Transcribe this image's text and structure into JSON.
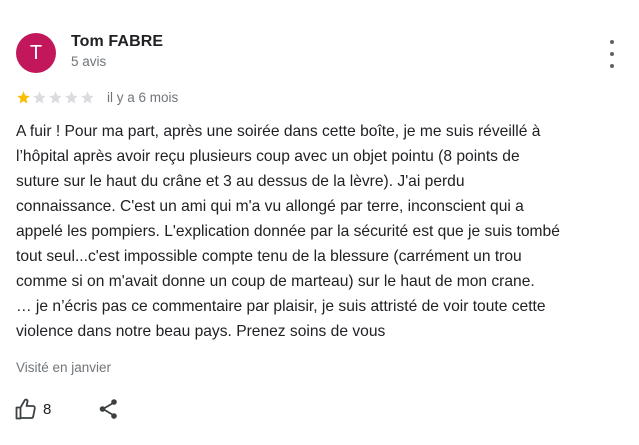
{
  "author": {
    "avatar_letter": "T",
    "avatar_color": "#c2185b",
    "name": "Tom FABRE",
    "review_count": "5 avis"
  },
  "menu": {
    "icon": "more-vert-icon"
  },
  "rating": {
    "stars_filled": 1,
    "stars_total": 5,
    "star_color": "#fbbc04",
    "star_empty_color": "#dadce0",
    "time_ago": "il y a 6 mois"
  },
  "review": {
    "text": "A fuir ! Pour ma part, après une soirée dans cette boîte, je me suis réveillé à\nl’hôpital après avoir reçu plusieurs coup avec un objet pointu (8 points de\nsuture sur le haut du crâne et 3 au dessus de la lèvre). J'ai perdu\nconnaissance. C'est un ami qui m'a vu allongé par terre, inconscient qui a\nappelé les pompiers. L'explication donnée par la sécurité est que je suis tombé\ntout seul...c'est impossible compte tenu de la blessure (carrément un trou\ncomme si on m'avait donne un coup de marteau) sur le haut de mon crane.\n… je n’écris pas ce commentaire par plaisir, je suis attristé de voir toute cette\nviolence dans notre beau pays. Prenez soins de vous"
  },
  "visit": {
    "label": "Visité en janvier"
  },
  "actions": {
    "like_count": "8",
    "like_icon": "thumb-up-icon",
    "share_icon": "share-icon"
  }
}
